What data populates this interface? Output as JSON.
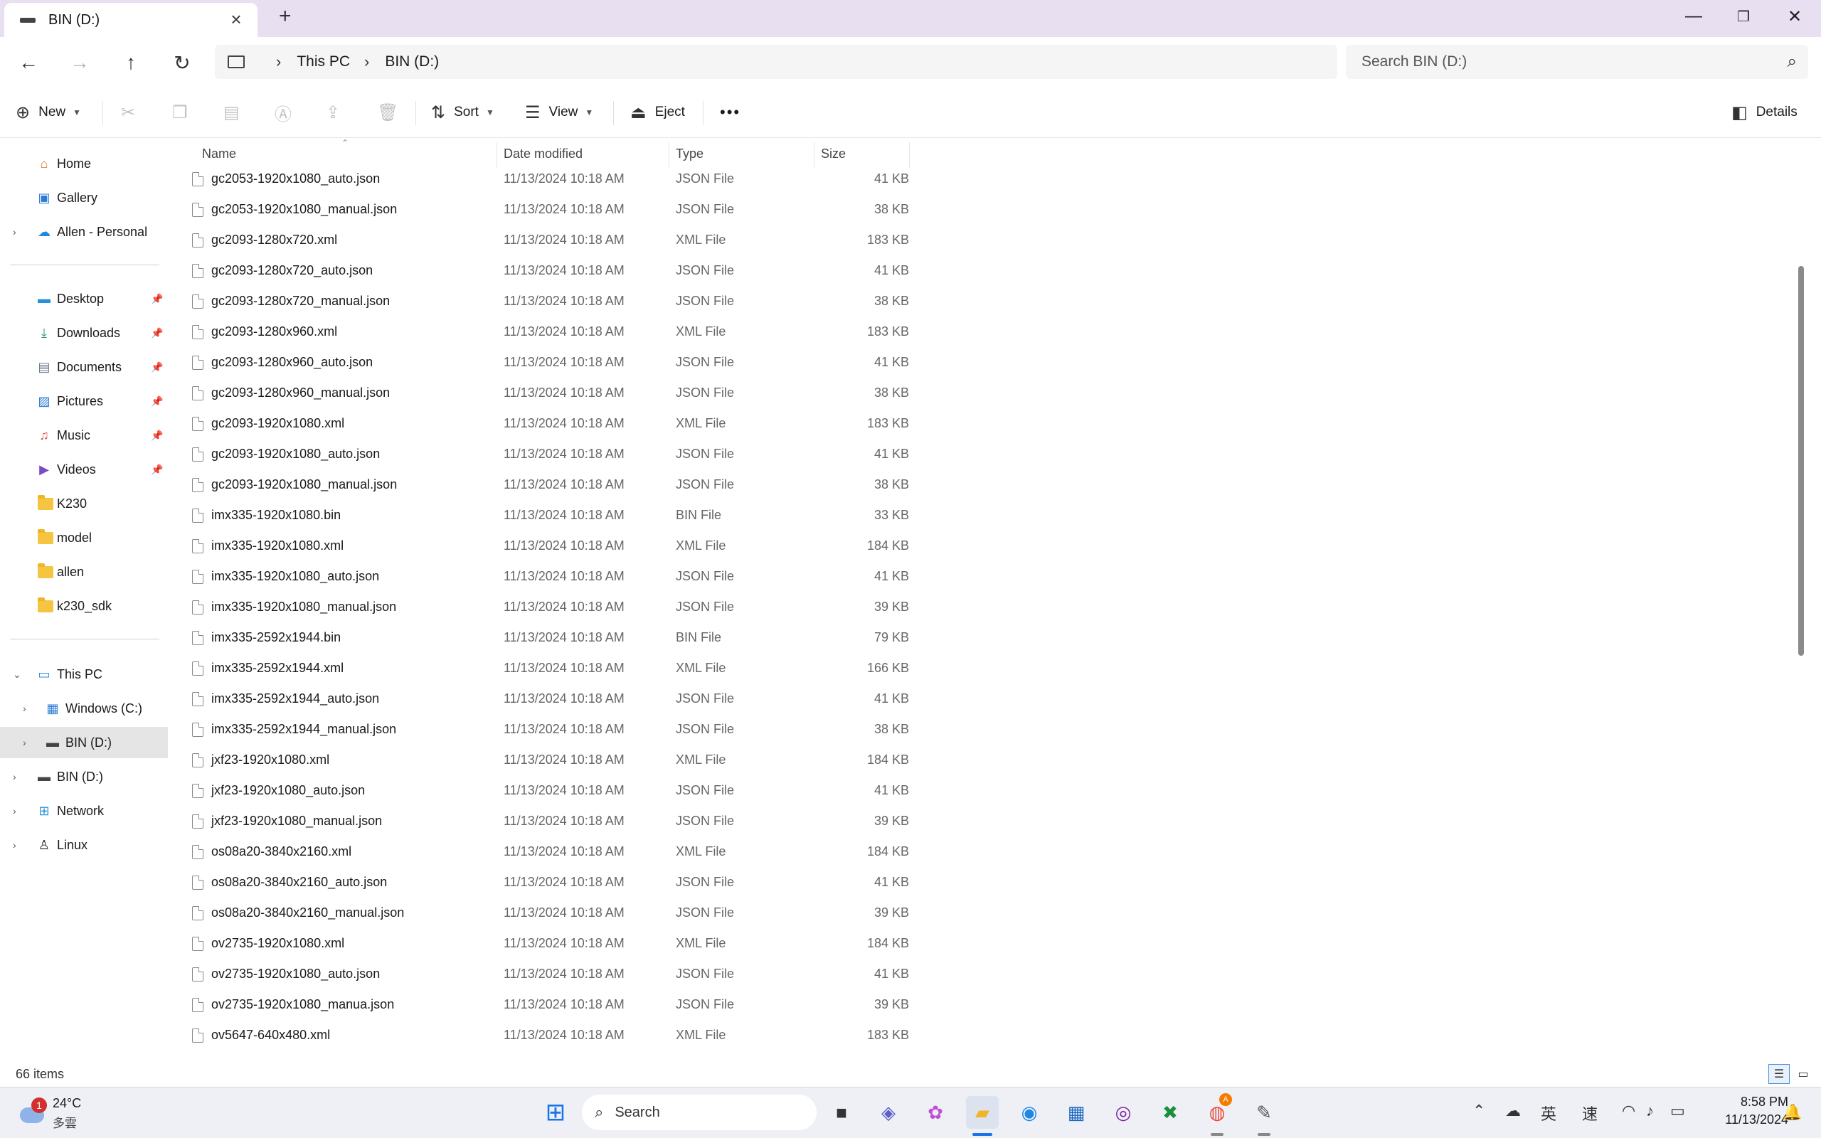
{
  "window": {
    "tab_title": "BIN (D:)",
    "controls": {
      "minimize": "—",
      "restore": "❐",
      "close": "✕"
    }
  },
  "address": {
    "crumbs": [
      "This PC",
      "BIN (D:)"
    ],
    "search_placeholder": "Search BIN (D:)"
  },
  "commands": {
    "new": "New",
    "sort": "Sort",
    "view": "View",
    "eject": "Eject",
    "more": "•••",
    "details": "Details"
  },
  "nav": {
    "quick": [
      "Home",
      "Gallery",
      "Allen - Personal"
    ],
    "pinned": [
      "Desktop",
      "Downloads",
      "Documents",
      "Pictures",
      "Music",
      "Videos"
    ],
    "folders": [
      "K230",
      "model",
      "allen",
      "k230_sdk"
    ],
    "tree": [
      "This PC",
      "Windows (C:)",
      "BIN (D:)",
      "BIN (D:)",
      "Network",
      "Linux"
    ]
  },
  "columns": {
    "name": "Name",
    "date": "Date modified",
    "type": "Type",
    "size": "Size"
  },
  "files": [
    {
      "name": "gc2053-1920x1080_auto.json",
      "date": "11/13/2024 10:18 AM",
      "type": "JSON File",
      "size": "41 KB"
    },
    {
      "name": "gc2053-1920x1080_manual.json",
      "date": "11/13/2024 10:18 AM",
      "type": "JSON File",
      "size": "38 KB"
    },
    {
      "name": "gc2093-1280x720.xml",
      "date": "11/13/2024 10:18 AM",
      "type": "XML File",
      "size": "183 KB"
    },
    {
      "name": "gc2093-1280x720_auto.json",
      "date": "11/13/2024 10:18 AM",
      "type": "JSON File",
      "size": "41 KB"
    },
    {
      "name": "gc2093-1280x720_manual.json",
      "date": "11/13/2024 10:18 AM",
      "type": "JSON File",
      "size": "38 KB"
    },
    {
      "name": "gc2093-1280x960.xml",
      "date": "11/13/2024 10:18 AM",
      "type": "XML File",
      "size": "183 KB"
    },
    {
      "name": "gc2093-1280x960_auto.json",
      "date": "11/13/2024 10:18 AM",
      "type": "JSON File",
      "size": "41 KB"
    },
    {
      "name": "gc2093-1280x960_manual.json",
      "date": "11/13/2024 10:18 AM",
      "type": "JSON File",
      "size": "38 KB"
    },
    {
      "name": "gc2093-1920x1080.xml",
      "date": "11/13/2024 10:18 AM",
      "type": "XML File",
      "size": "183 KB"
    },
    {
      "name": "gc2093-1920x1080_auto.json",
      "date": "11/13/2024 10:18 AM",
      "type": "JSON File",
      "size": "41 KB"
    },
    {
      "name": "gc2093-1920x1080_manual.json",
      "date": "11/13/2024 10:18 AM",
      "type": "JSON File",
      "size": "38 KB"
    },
    {
      "name": "imx335-1920x1080.bin",
      "date": "11/13/2024 10:18 AM",
      "type": "BIN File",
      "size": "33 KB"
    },
    {
      "name": "imx335-1920x1080.xml",
      "date": "11/13/2024 10:18 AM",
      "type": "XML File",
      "size": "184 KB"
    },
    {
      "name": "imx335-1920x1080_auto.json",
      "date": "11/13/2024 10:18 AM",
      "type": "JSON File",
      "size": "41 KB"
    },
    {
      "name": "imx335-1920x1080_manual.json",
      "date": "11/13/2024 10:18 AM",
      "type": "JSON File",
      "size": "39 KB"
    },
    {
      "name": "imx335-2592x1944.bin",
      "date": "11/13/2024 10:18 AM",
      "type": "BIN File",
      "size": "79 KB"
    },
    {
      "name": "imx335-2592x1944.xml",
      "date": "11/13/2024 10:18 AM",
      "type": "XML File",
      "size": "166 KB"
    },
    {
      "name": "imx335-2592x1944_auto.json",
      "date": "11/13/2024 10:18 AM",
      "type": "JSON File",
      "size": "41 KB"
    },
    {
      "name": "imx335-2592x1944_manual.json",
      "date": "11/13/2024 10:18 AM",
      "type": "JSON File",
      "size": "38 KB"
    },
    {
      "name": "jxf23-1920x1080.xml",
      "date": "11/13/2024 10:18 AM",
      "type": "XML File",
      "size": "184 KB"
    },
    {
      "name": "jxf23-1920x1080_auto.json",
      "date": "11/13/2024 10:18 AM",
      "type": "JSON File",
      "size": "41 KB"
    },
    {
      "name": "jxf23-1920x1080_manual.json",
      "date": "11/13/2024 10:18 AM",
      "type": "JSON File",
      "size": "39 KB"
    },
    {
      "name": "os08a20-3840x2160.xml",
      "date": "11/13/2024 10:18 AM",
      "type": "XML File",
      "size": "184 KB"
    },
    {
      "name": "os08a20-3840x2160_auto.json",
      "date": "11/13/2024 10:18 AM",
      "type": "JSON File",
      "size": "41 KB"
    },
    {
      "name": "os08a20-3840x2160_manual.json",
      "date": "11/13/2024 10:18 AM",
      "type": "JSON File",
      "size": "39 KB"
    },
    {
      "name": "ov2735-1920x1080.xml",
      "date": "11/13/2024 10:18 AM",
      "type": "XML File",
      "size": "184 KB"
    },
    {
      "name": "ov2735-1920x1080_auto.json",
      "date": "11/13/2024 10:18 AM",
      "type": "JSON File",
      "size": "41 KB"
    },
    {
      "name": "ov2735-1920x1080_manua.json",
      "date": "11/13/2024 10:18 AM",
      "type": "JSON File",
      "size": "39 KB"
    },
    {
      "name": "ov5647-640x480.xml",
      "date": "11/13/2024 10:18 AM",
      "type": "XML File",
      "size": "183 KB"
    }
  ],
  "status": {
    "item_count": "66 items"
  },
  "taskbar": {
    "weather_badge": "1",
    "temperature": "24°C",
    "condition": "多雲",
    "search_label": "Search",
    "ime_1": "英",
    "ime_2": "速",
    "time": "8:58 PM",
    "date": "11/13/2024",
    "chrome_badge": "A"
  }
}
